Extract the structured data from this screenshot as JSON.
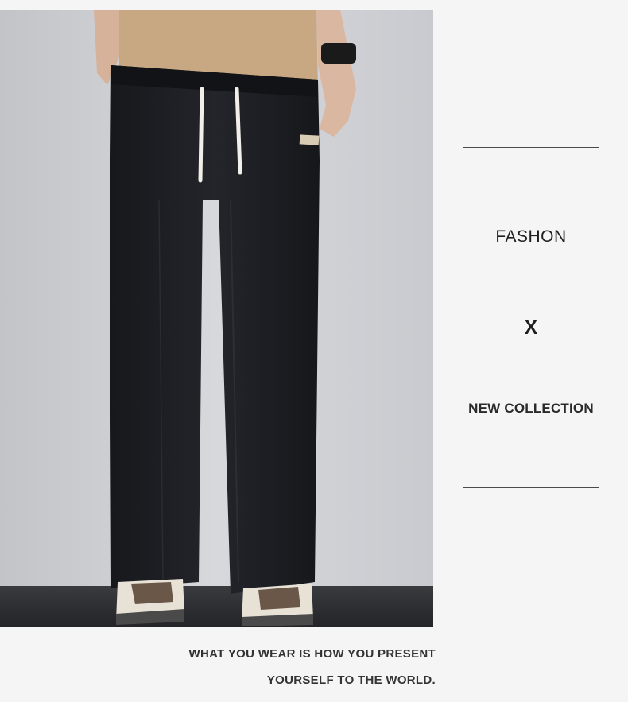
{
  "photo": {
    "subject": "model wearing black wide-leg drawstring trousers with white sneakers",
    "colors": {
      "wall": "#cfd0d4",
      "floor": "#2f3033",
      "pants": "#1c1d22",
      "tshirt": "#c7a882",
      "drawstring": "#f2efe8",
      "patch": "#d9ccb4"
    }
  },
  "card": {
    "line1": "FASHON",
    "line2": "X",
    "line3": "NEW COLLECTION"
  },
  "tagline": {
    "line1": "WHAT YOU WEAR IS HOW YOU PRESENT",
    "line2": "YOURSELF TO THE WORLD."
  }
}
